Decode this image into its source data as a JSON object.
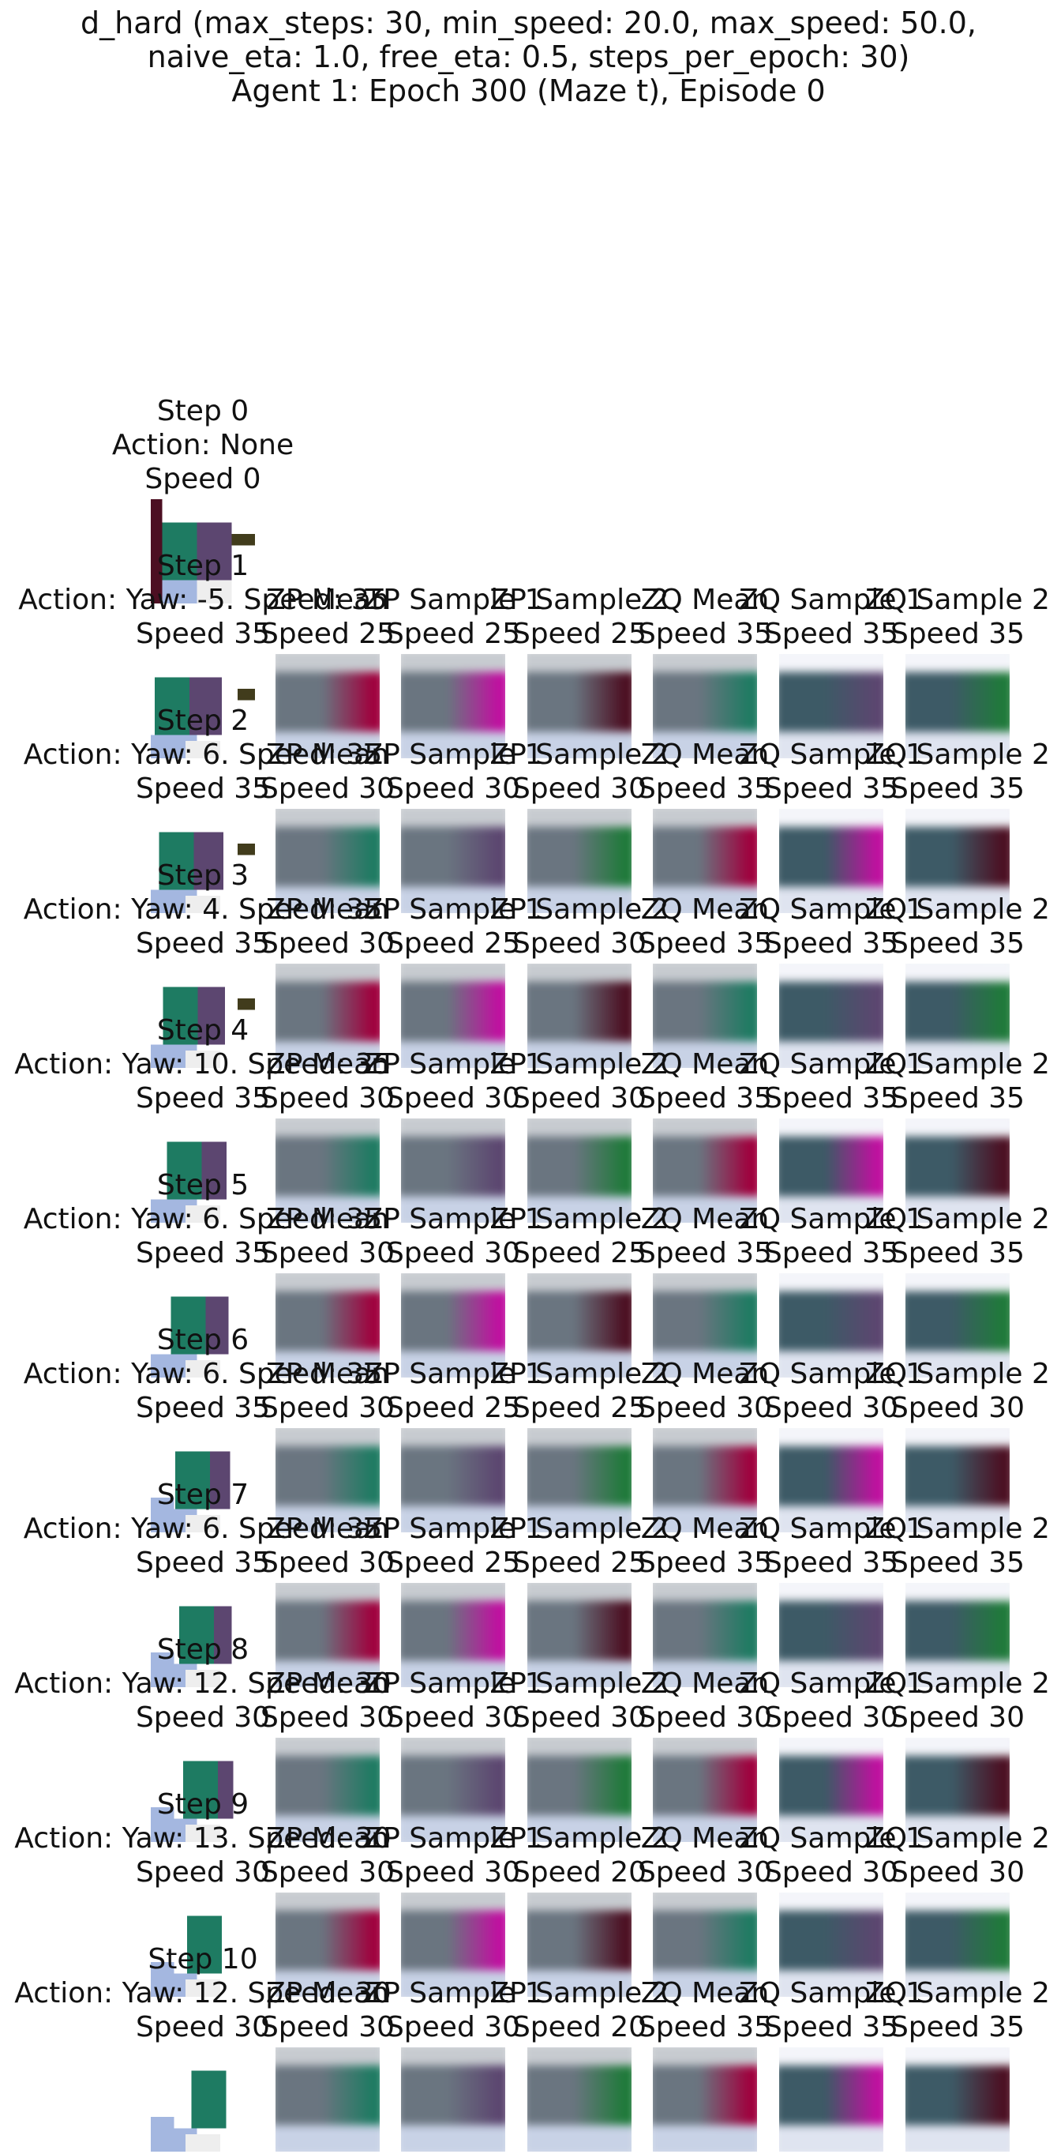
{
  "figure": {
    "title_lines": [
      "d_hard (max_steps: 30, min_speed: 20.0, max_speed: 50.0,",
      "naive_eta: 1.0, free_eta: 0.5, steps_per_epoch: 30)",
      "Agent 1: Epoch 300 (Maze t), Episode 0"
    ]
  },
  "palette": {
    "teal": "#1e7b62",
    "purple": "#5c4670",
    "light_blue": "#a4b7e0",
    "pale": "#eeeeee",
    "dark_olive": "#413c1c",
    "maroon": "#4c0f22",
    "crimson": "#a0003d",
    "magenta": "#c010a0",
    "green": "#1f7a3a",
    "slate": "#3d5a66",
    "grey_slate": "#6a7580",
    "white": "#ffffff"
  },
  "columns": [
    "",
    "ZP Mean",
    "ZP Sample 1",
    "ZP Sample 2",
    "ZQ Mean",
    "ZQ Sample 1",
    "ZQ Sample 2"
  ],
  "rows": [
    {
      "step": "Step 0",
      "action": "Action: None",
      "speed": "Speed 0",
      "speeds": []
    },
    {
      "step": "Step 1",
      "action": "Action: Yaw: -5. Speed: 35",
      "speed": "Speed 35",
      "speeds": [
        "Speed 25",
        "Speed 25",
        "Speed 25",
        "Speed 35",
        "Speed 35",
        "Speed 35"
      ]
    },
    {
      "step": "Step 2",
      "action": "Action: Yaw: 6. Speed: 35",
      "speed": "Speed 35",
      "speeds": [
        "Speed 30",
        "Speed 30",
        "Speed 30",
        "Speed 35",
        "Speed 35",
        "Speed 35"
      ]
    },
    {
      "step": "Step 3",
      "action": "Action: Yaw: 4. Speed: 35",
      "speed": "Speed 35",
      "speeds": [
        "Speed 30",
        "Speed 25",
        "Speed 30",
        "Speed 35",
        "Speed 35",
        "Speed 35"
      ]
    },
    {
      "step": "Step 4",
      "action": "Action: Yaw: 10. Speed: 35",
      "speed": "Speed 35",
      "speeds": [
        "Speed 30",
        "Speed 30",
        "Speed 30",
        "Speed 35",
        "Speed 35",
        "Speed 35"
      ]
    },
    {
      "step": "Step 5",
      "action": "Action: Yaw: 6. Speed: 35",
      "speed": "Speed 35",
      "speeds": [
        "Speed 30",
        "Speed 30",
        "Speed 25",
        "Speed 35",
        "Speed 35",
        "Speed 35"
      ]
    },
    {
      "step": "Step 6",
      "action": "Action: Yaw: 6. Speed: 35",
      "speed": "Speed 35",
      "speeds": [
        "Speed 30",
        "Speed 25",
        "Speed 25",
        "Speed 30",
        "Speed 30",
        "Speed 30"
      ]
    },
    {
      "step": "Step 7",
      "action": "Action: Yaw: 6. Speed: 35",
      "speed": "Speed 35",
      "speeds": [
        "Speed 30",
        "Speed 25",
        "Speed 25",
        "Speed 35",
        "Speed 35",
        "Speed 35"
      ]
    },
    {
      "step": "Step 8",
      "action": "Action: Yaw: 12. Speed: 30",
      "speed": "Speed 30",
      "speeds": [
        "Speed 30",
        "Speed 30",
        "Speed 30",
        "Speed 30",
        "Speed 30",
        "Speed 30"
      ]
    },
    {
      "step": "Step 9",
      "action": "Action: Yaw: 13. Speed: 30",
      "speed": "Speed 30",
      "speeds": [
        "Speed 30",
        "Speed 30",
        "Speed 20",
        "Speed 30",
        "Speed 30",
        "Speed 30"
      ]
    },
    {
      "step": "Step 10",
      "action": "Action: Yaw: 12. Speed: 30",
      "speed": "Speed 30",
      "speeds": [
        "Speed 30",
        "Speed 30",
        "Speed 20",
        "Speed 35",
        "Speed 35",
        "Speed 35"
      ]
    }
  ]
}
